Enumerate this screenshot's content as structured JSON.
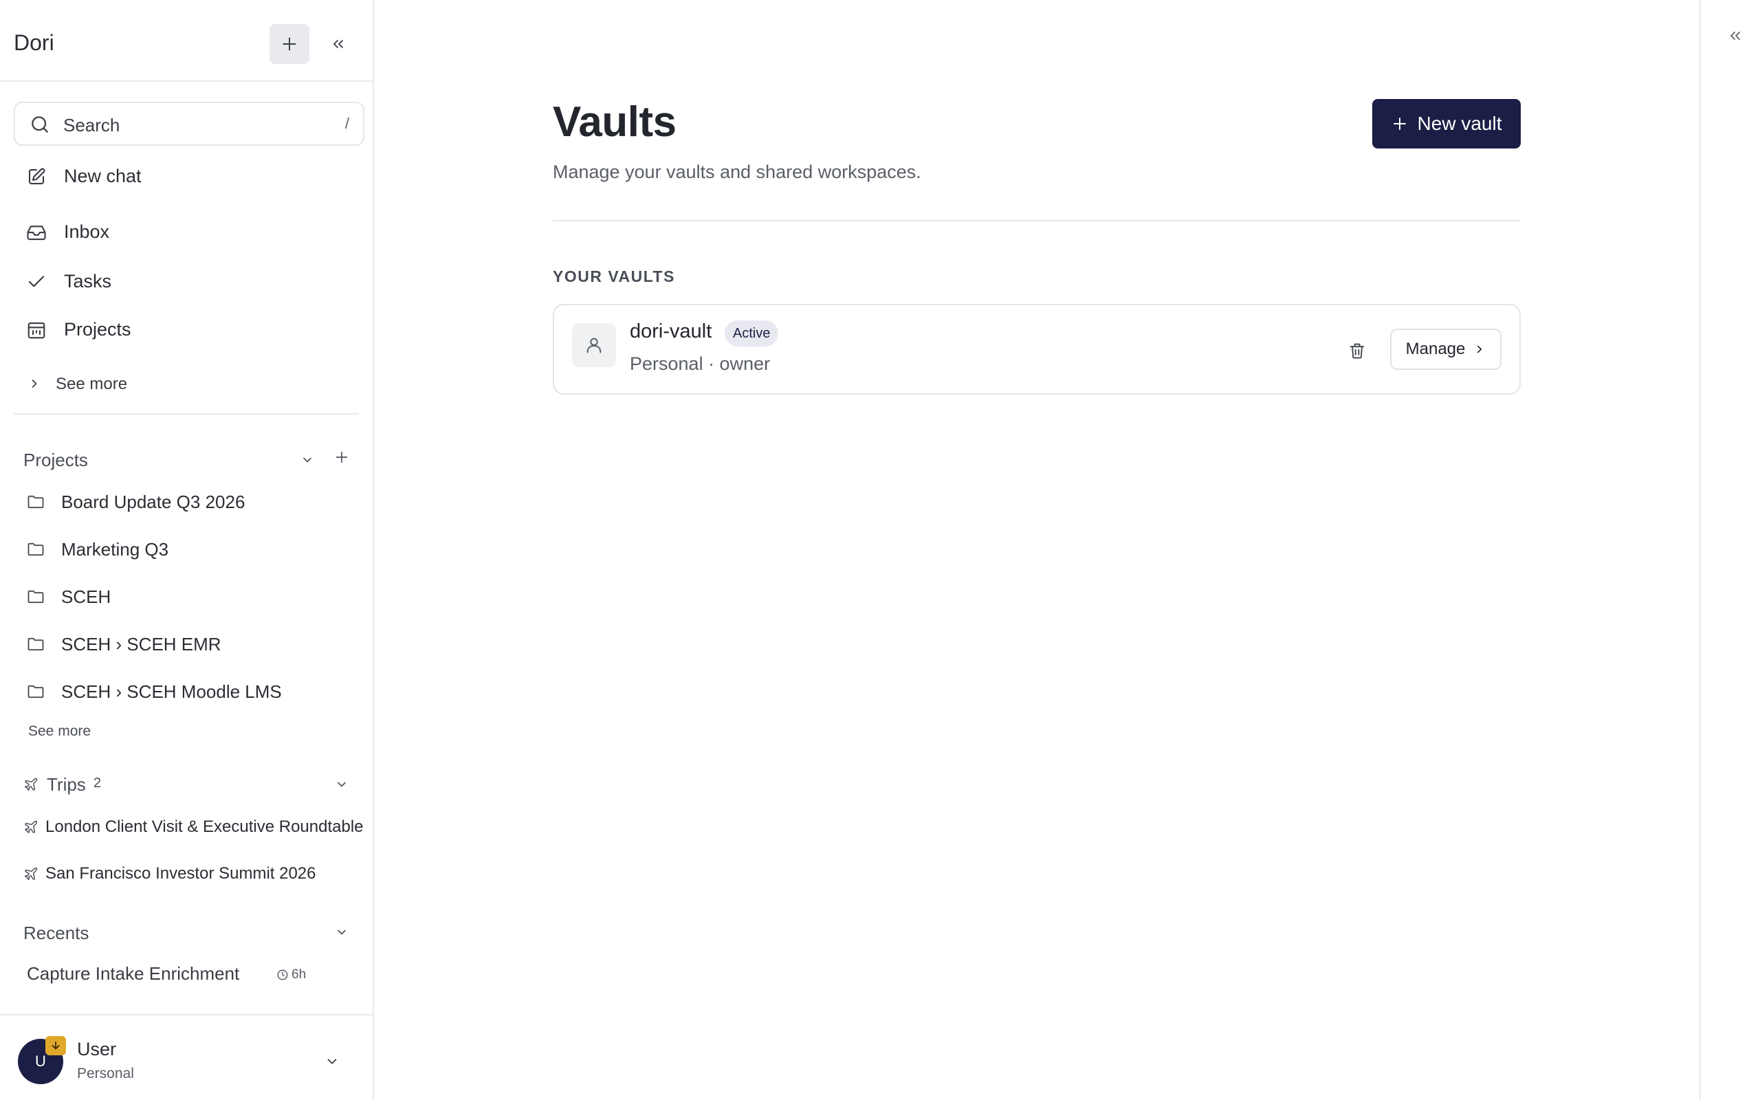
{
  "app": {
    "name": "Dori"
  },
  "sidebar": {
    "search": {
      "label": "Search",
      "shortcut": "/"
    },
    "nav": [
      {
        "label": "New chat",
        "icon": "pencil-square-icon"
      },
      {
        "label": "Inbox",
        "icon": "inbox-icon"
      },
      {
        "label": "Tasks",
        "icon": "check-icon"
      },
      {
        "label": "Projects",
        "icon": "calendar-folder-icon"
      }
    ],
    "see_more": "See more",
    "projects": {
      "title": "Projects",
      "items": [
        {
          "label": "Board Update Q3 2026"
        },
        {
          "label": "Marketing Q3"
        },
        {
          "label": "SCEH"
        },
        {
          "label": "SCEH › SCEH EMR"
        },
        {
          "label": "SCEH › SCEH Moodle LMS"
        }
      ],
      "see_more": "See more"
    },
    "trips": {
      "title": "Trips",
      "count": "2",
      "items": [
        {
          "label": "London Client Visit & Executive Roundtable"
        },
        {
          "label": "San Francisco Investor Summit 2026"
        }
      ]
    },
    "recents": {
      "title": "Recents",
      "items": [
        {
          "label": "Capture Intake Enrichment",
          "time": "6h"
        }
      ]
    },
    "user": {
      "initial": "U",
      "name": "User",
      "plan": "Personal"
    }
  },
  "main": {
    "title": "Vaults",
    "subtitle": "Manage your vaults and shared workspaces.",
    "new_vault_label": "New vault",
    "section_heading": "YOUR VAULTS",
    "vaults": [
      {
        "name": "dori-vault",
        "status": "Active",
        "meta": "Personal · owner",
        "manage_label": "Manage"
      }
    ]
  },
  "colors": {
    "accent": "#1b1f45",
    "badge": "#e0a72b",
    "border": "#e3e5e9"
  }
}
